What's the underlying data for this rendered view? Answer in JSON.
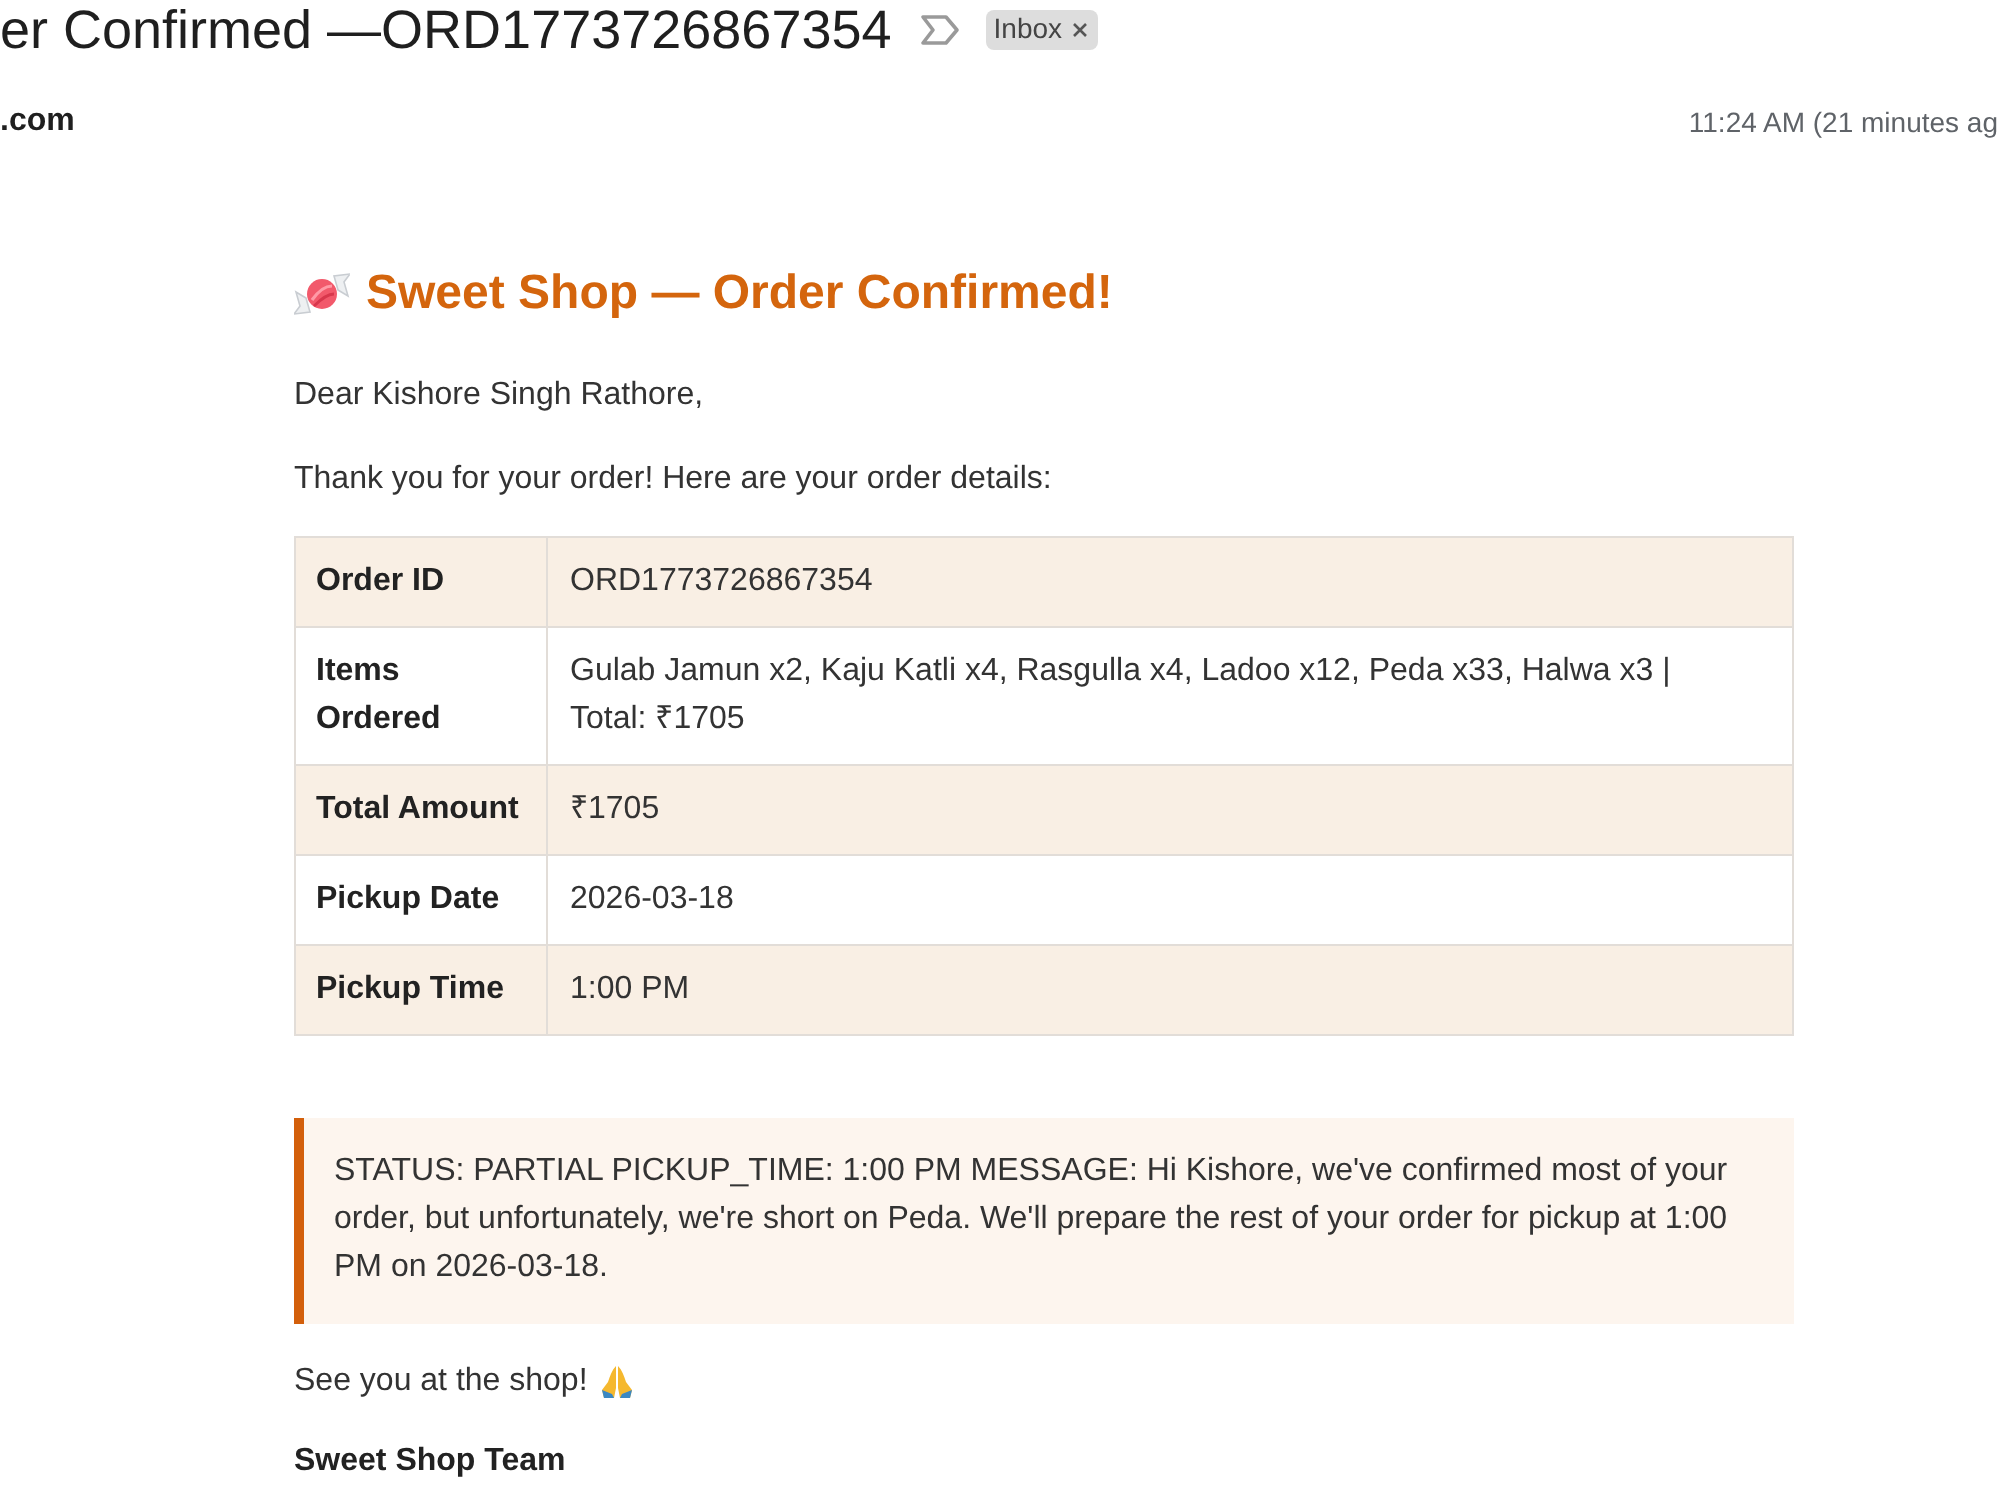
{
  "subject": {
    "title": "er Confirmed —ORD1773726867354",
    "label": "Inbox"
  },
  "sender": {
    "address": ".com",
    "time": "11:24 AM (21 minutes ag"
  },
  "email": {
    "heading": "Sweet Shop — Order Confirmed!",
    "greeting": "Dear Kishore Singh Rathore,",
    "intro": "Thank you for your order! Here are your order details:",
    "table": {
      "rows": [
        {
          "label": "Order ID",
          "value": "ORD1773726867354"
        },
        {
          "label": "Items Ordered",
          "value": "Gulab Jamun x2, Kaju Katli x4, Rasgulla x4, Ladoo x12, Peda x33, Halwa x3 | Total: ₹1705"
        },
        {
          "label": "Total Amount",
          "value": "₹1705"
        },
        {
          "label": "Pickup Date",
          "value": "2026-03-18"
        },
        {
          "label": "Pickup Time",
          "value": "1:00 PM"
        }
      ]
    },
    "status_message": "STATUS: PARTIAL PICKUP_TIME: 1:00 PM MESSAGE: Hi Kishore, we've confirmed most of your order, but unfortunately, we're short on Peda. We'll prepare the rest of your order for pickup at 1:00 PM on 2026-03-18.",
    "closing": "See you at the shop!",
    "signature": "Sweet Shop Team"
  }
}
